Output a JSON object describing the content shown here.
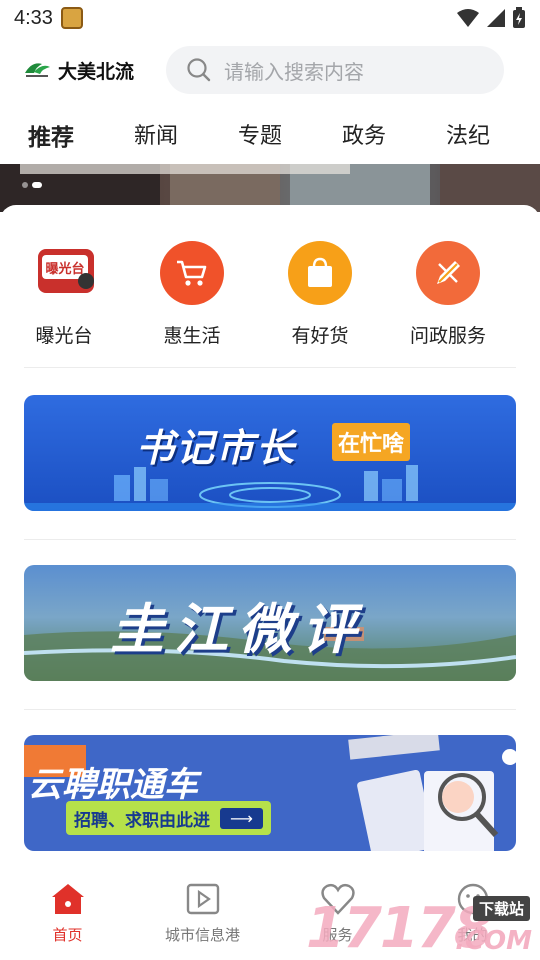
{
  "status": {
    "time": "4:33"
  },
  "header": {
    "logo_text": "大美北流",
    "search_placeholder": "请输入搜索内容"
  },
  "tabs": [
    {
      "label": "推荐",
      "active": true
    },
    {
      "label": "新闻"
    },
    {
      "label": "专题"
    },
    {
      "label": "政务"
    },
    {
      "label": "法纪"
    }
  ],
  "quick_links": [
    {
      "label": "曝光台",
      "icon": "exposure-badge-icon",
      "color": "#d9362c"
    },
    {
      "label": "惠生活",
      "icon": "shopping-cart-icon",
      "color": "#f0522a"
    },
    {
      "label": "有好货",
      "icon": "shopping-bag-icon",
      "color": "#f7a018"
    },
    {
      "label": "问政服务",
      "icon": "pencil-icon",
      "color": "#f26a3a"
    }
  ],
  "promos": [
    {
      "title": "书记市长",
      "tag": "在忙啥"
    },
    {
      "title": "圭江微评"
    },
    {
      "title": "云聘职通车",
      "subtitle": "招聘、求职由此进"
    }
  ],
  "bottom_nav": [
    {
      "label": "首页",
      "icon": "home-icon",
      "active": true
    },
    {
      "label": "城市信息港",
      "icon": "play-icon"
    },
    {
      "label": "服务",
      "icon": "heart-icon"
    },
    {
      "label": "我的",
      "icon": "face-icon"
    }
  ],
  "watermark": {
    "text": "17178",
    "suffix": ".COM",
    "badge": "下载站"
  },
  "colors": {
    "accent": "#e0312a",
    "banner_blue": "#1e5fd6"
  }
}
